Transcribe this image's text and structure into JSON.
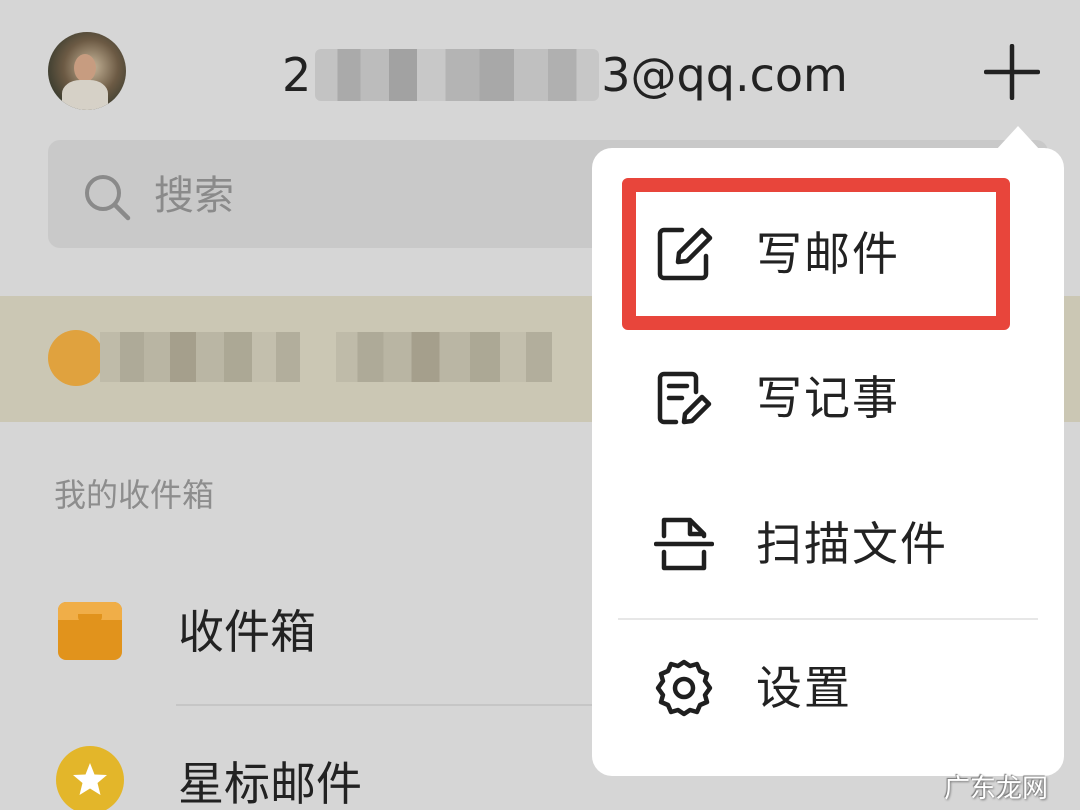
{
  "header": {
    "account_prefix": "2",
    "account_suffix": "3@qq.com",
    "avatar_icon": "user-avatar",
    "plus_icon": "plus-icon"
  },
  "search": {
    "placeholder": "搜索",
    "icon": "search-icon"
  },
  "banner": {
    "icon": "orange-avatar"
  },
  "inbox_section": {
    "title": "我的收件箱",
    "items": [
      {
        "label": "收件箱",
        "icon": "inbox-icon",
        "color": "#e1931c"
      },
      {
        "label": "星标邮件",
        "icon": "star-icon",
        "color": "#e3b62a"
      }
    ]
  },
  "menu": {
    "items": [
      {
        "label": "写邮件",
        "icon": "compose-icon",
        "highlighted": true
      },
      {
        "label": "写记事",
        "icon": "note-icon"
      },
      {
        "label": "扫描文件",
        "icon": "scan-icon"
      },
      {
        "label": "设置",
        "icon": "gear-icon"
      }
    ],
    "highlight_color": "#e8453b"
  },
  "watermark": "广东龙网"
}
